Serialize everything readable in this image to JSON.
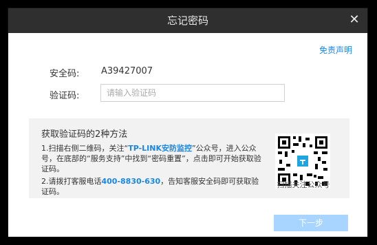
{
  "dialog": {
    "title": "忘记密码",
    "close_icon": "close-icon",
    "disclaimer_label": "免责声明"
  },
  "form": {
    "security_code_label": "安全码:",
    "security_code_value": "A39427007",
    "verify_code_label": "验证码:",
    "verify_code_placeholder": "请输入验证码",
    "verify_code_value": ""
  },
  "help": {
    "title": "获取验证码的2种方法",
    "method1_prefix": "1.扫描右侧二维码，关注“",
    "method1_account": "TP-LINK安防监控",
    "method1_suffix": "”公众号，进入公众号，在底部的“服务支持”中找到“密码重置”，点击即可开始获取验证码。",
    "method2_prefix": "2.请拨打客服电话",
    "method2_phone": "400-8830-630",
    "method2_suffix": "，告知客服安全码即可获取验证码。",
    "qr_icon": "qr-code-icon",
    "qr_caption": "扫描关注公众号"
  },
  "actions": {
    "next_label": "下一步"
  },
  "colors": {
    "accent": "#1a86e5",
    "titlebar": "#2f2f2f",
    "next_button_disabled": "#a8d5ff"
  }
}
